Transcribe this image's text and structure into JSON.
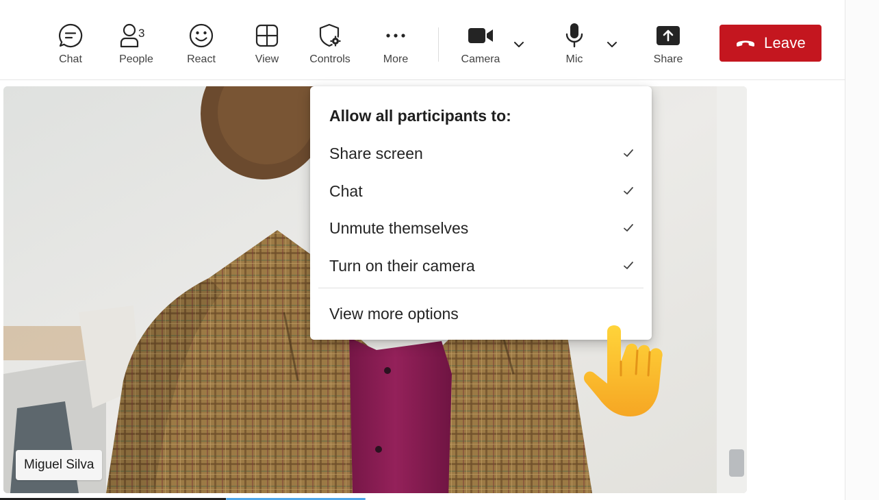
{
  "toolbar": {
    "chat_label": "Chat",
    "people_label": "People",
    "people_count": "3",
    "react_label": "React",
    "view_label": "View",
    "controls_label": "Controls",
    "more_label": "More",
    "camera_label": "Camera",
    "mic_label": "Mic",
    "share_label": "Share",
    "leave_label": "Leave"
  },
  "video": {
    "participant_name": "Miguel Silva"
  },
  "controls_menu": {
    "header": "Allow all participants to:",
    "items": [
      {
        "label": "Share screen",
        "checked": true
      },
      {
        "label": "Chat",
        "checked": true
      },
      {
        "label": "Unmute themselves",
        "checked": true
      },
      {
        "label": "Turn on their camera",
        "checked": true
      }
    ],
    "more_options_label": "View more options"
  },
  "colors": {
    "leave_red": "#c4161f",
    "jacket_tan": "#9c7a45",
    "shirt_magenta": "#8a1d52",
    "wall": "#e9e9e7"
  },
  "icons": {
    "chat": "chat-bubble-icon",
    "people": "people-icon",
    "react": "emoji-icon",
    "view": "grid-view-icon",
    "controls": "shield-gear-icon",
    "more": "more-dots-icon",
    "camera": "video-camera-icon",
    "mic": "microphone-icon",
    "share": "share-tray-icon",
    "leave": "phone-hangup-icon",
    "cursor": "pointing-hand-icon"
  }
}
